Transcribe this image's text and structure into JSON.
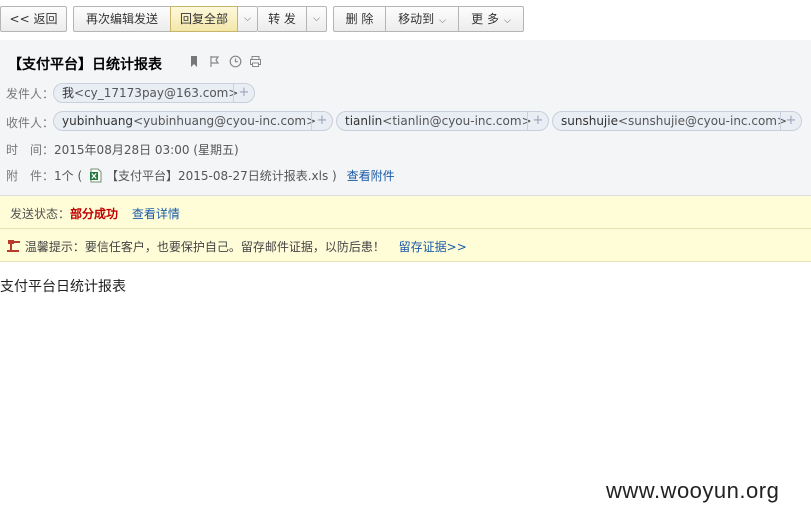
{
  "toolbar": {
    "back": "<< 返回",
    "reedit": "再次编辑发送",
    "reply_all": "回复全部",
    "forward": "转 发",
    "delete": "删 除",
    "move_to": "移动到",
    "more": "更 多"
  },
  "mail": {
    "subject": "【支付平台】日统计报表",
    "from_label": "发件人：",
    "from_name": "我",
    "from_addr": "<cy_17173pay@163.com>",
    "to_label": "收件人：",
    "recipients": [
      {
        "name": "yubinhuang",
        "addr": "<yubinhuang@cyou-inc.com>"
      },
      {
        "name": "tianlin",
        "addr": "<tianlin@cyou-inc.com>"
      },
      {
        "name": "sunshujie",
        "addr": "<sunshujie@cyou-inc.com>"
      }
    ],
    "time_label": "时　间：",
    "time_value": "2015年08月28日 03:00 (星期五)",
    "attach_label": "附　件：",
    "attach_count": "1个 (",
    "attach_file": "【支付平台】2015-08-27日统计报表.xls )",
    "attach_view": "查看附件",
    "body": "支付平台日统计报表"
  },
  "status": {
    "label": "发送状态：",
    "value": "部分成功",
    "detail_link": "查看详情",
    "value_color": "#c00000"
  },
  "tip": {
    "text": "温馨提示：要信任客户，也要保护自己。留存邮件证据，以防后患！",
    "link": "留存证据>>"
  },
  "watermark": "www.wooyun.org"
}
